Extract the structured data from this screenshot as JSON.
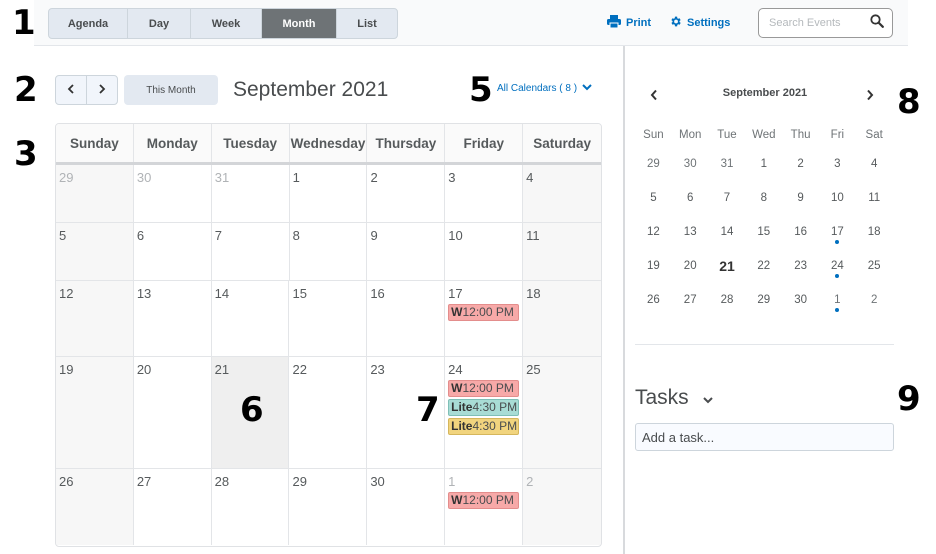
{
  "markers": [
    "1",
    "2",
    "3",
    "4",
    "5",
    "6",
    "7",
    "8",
    "9"
  ],
  "toolbar": {
    "views": [
      {
        "label": "Agenda",
        "active": false
      },
      {
        "label": "Day",
        "active": false
      },
      {
        "label": "Week",
        "active": false
      },
      {
        "label": "Month",
        "active": true
      },
      {
        "label": "List",
        "active": false
      }
    ],
    "print_label": "Print",
    "settings_label": "Settings",
    "search_placeholder": "Search Events",
    "accent_color": "#006fbf"
  },
  "nav": {
    "prev_icon": "chevron-left-icon",
    "next_icon": "chevron-right-icon",
    "this_month_label": "This Month",
    "month_title": "September 2021",
    "calendars_label": "All Calendars ( 8 )"
  },
  "month_grid": {
    "day_names": [
      "Sunday",
      "Monday",
      "Tuesday",
      "Wednesday",
      "Thursday",
      "Friday",
      "Saturday"
    ],
    "weeks": [
      [
        {
          "day": "29",
          "other": true
        },
        {
          "day": "30",
          "other": true
        },
        {
          "day": "31",
          "other": true
        },
        {
          "day": "1"
        },
        {
          "day": "2"
        },
        {
          "day": "3"
        },
        {
          "day": "4"
        }
      ],
      [
        {
          "day": "5"
        },
        {
          "day": "6"
        },
        {
          "day": "7"
        },
        {
          "day": "8"
        },
        {
          "day": "9"
        },
        {
          "day": "10"
        },
        {
          "day": "11"
        }
      ],
      [
        {
          "day": "12"
        },
        {
          "day": "13"
        },
        {
          "day": "14"
        },
        {
          "day": "15"
        },
        {
          "day": "16"
        },
        {
          "day": "17",
          "events": [
            {
              "prefix": "W",
              "time": "12:00 PM",
              "color": "red"
            }
          ]
        },
        {
          "day": "18"
        }
      ],
      [
        {
          "day": "19"
        },
        {
          "day": "20"
        },
        {
          "day": "21",
          "today": true
        },
        {
          "day": "22"
        },
        {
          "day": "23"
        },
        {
          "day": "24",
          "events": [
            {
              "prefix": "W",
              "time": "12:00 PM",
              "color": "red"
            },
            {
              "prefix": "Lite",
              "time": "4:30 PM",
              "color": "teal"
            },
            {
              "prefix": "Lite",
              "time": "4:30 PM",
              "color": "yellow"
            }
          ]
        },
        {
          "day": "25"
        }
      ],
      [
        {
          "day": "26"
        },
        {
          "day": "27"
        },
        {
          "day": "28"
        },
        {
          "day": "29"
        },
        {
          "day": "30"
        },
        {
          "day": "1",
          "other": true,
          "events": [
            {
              "prefix": "W",
              "time": "12:00 PM",
              "color": "red"
            }
          ]
        },
        {
          "day": "2",
          "other": true
        }
      ]
    ]
  },
  "mini_calendar": {
    "title": "September 2021",
    "day_names": [
      "Sun",
      "Mon",
      "Tue",
      "Wed",
      "Thu",
      "Fri",
      "Sat"
    ],
    "weeks": [
      [
        {
          "d": "29",
          "o": true
        },
        {
          "d": "30",
          "o": true
        },
        {
          "d": "31",
          "o": true
        },
        {
          "d": "1"
        },
        {
          "d": "2"
        },
        {
          "d": "3"
        },
        {
          "d": "4"
        }
      ],
      [
        {
          "d": "5"
        },
        {
          "d": "6"
        },
        {
          "d": "7"
        },
        {
          "d": "8"
        },
        {
          "d": "9"
        },
        {
          "d": "10"
        },
        {
          "d": "11"
        }
      ],
      [
        {
          "d": "12"
        },
        {
          "d": "13"
        },
        {
          "d": "14"
        },
        {
          "d": "15"
        },
        {
          "d": "16"
        },
        {
          "d": "17",
          "dot": true
        },
        {
          "d": "18"
        }
      ],
      [
        {
          "d": "19"
        },
        {
          "d": "20"
        },
        {
          "d": "21",
          "today": true
        },
        {
          "d": "22"
        },
        {
          "d": "23"
        },
        {
          "d": "24",
          "dot": true
        },
        {
          "d": "25"
        }
      ],
      [
        {
          "d": "26"
        },
        {
          "d": "27"
        },
        {
          "d": "28"
        },
        {
          "d": "29"
        },
        {
          "d": "30"
        },
        {
          "d": "1",
          "o": true,
          "dot": true
        },
        {
          "d": "2",
          "o": true
        }
      ]
    ]
  },
  "tasks": {
    "title": "Tasks",
    "input_placeholder": "Add a task..."
  }
}
